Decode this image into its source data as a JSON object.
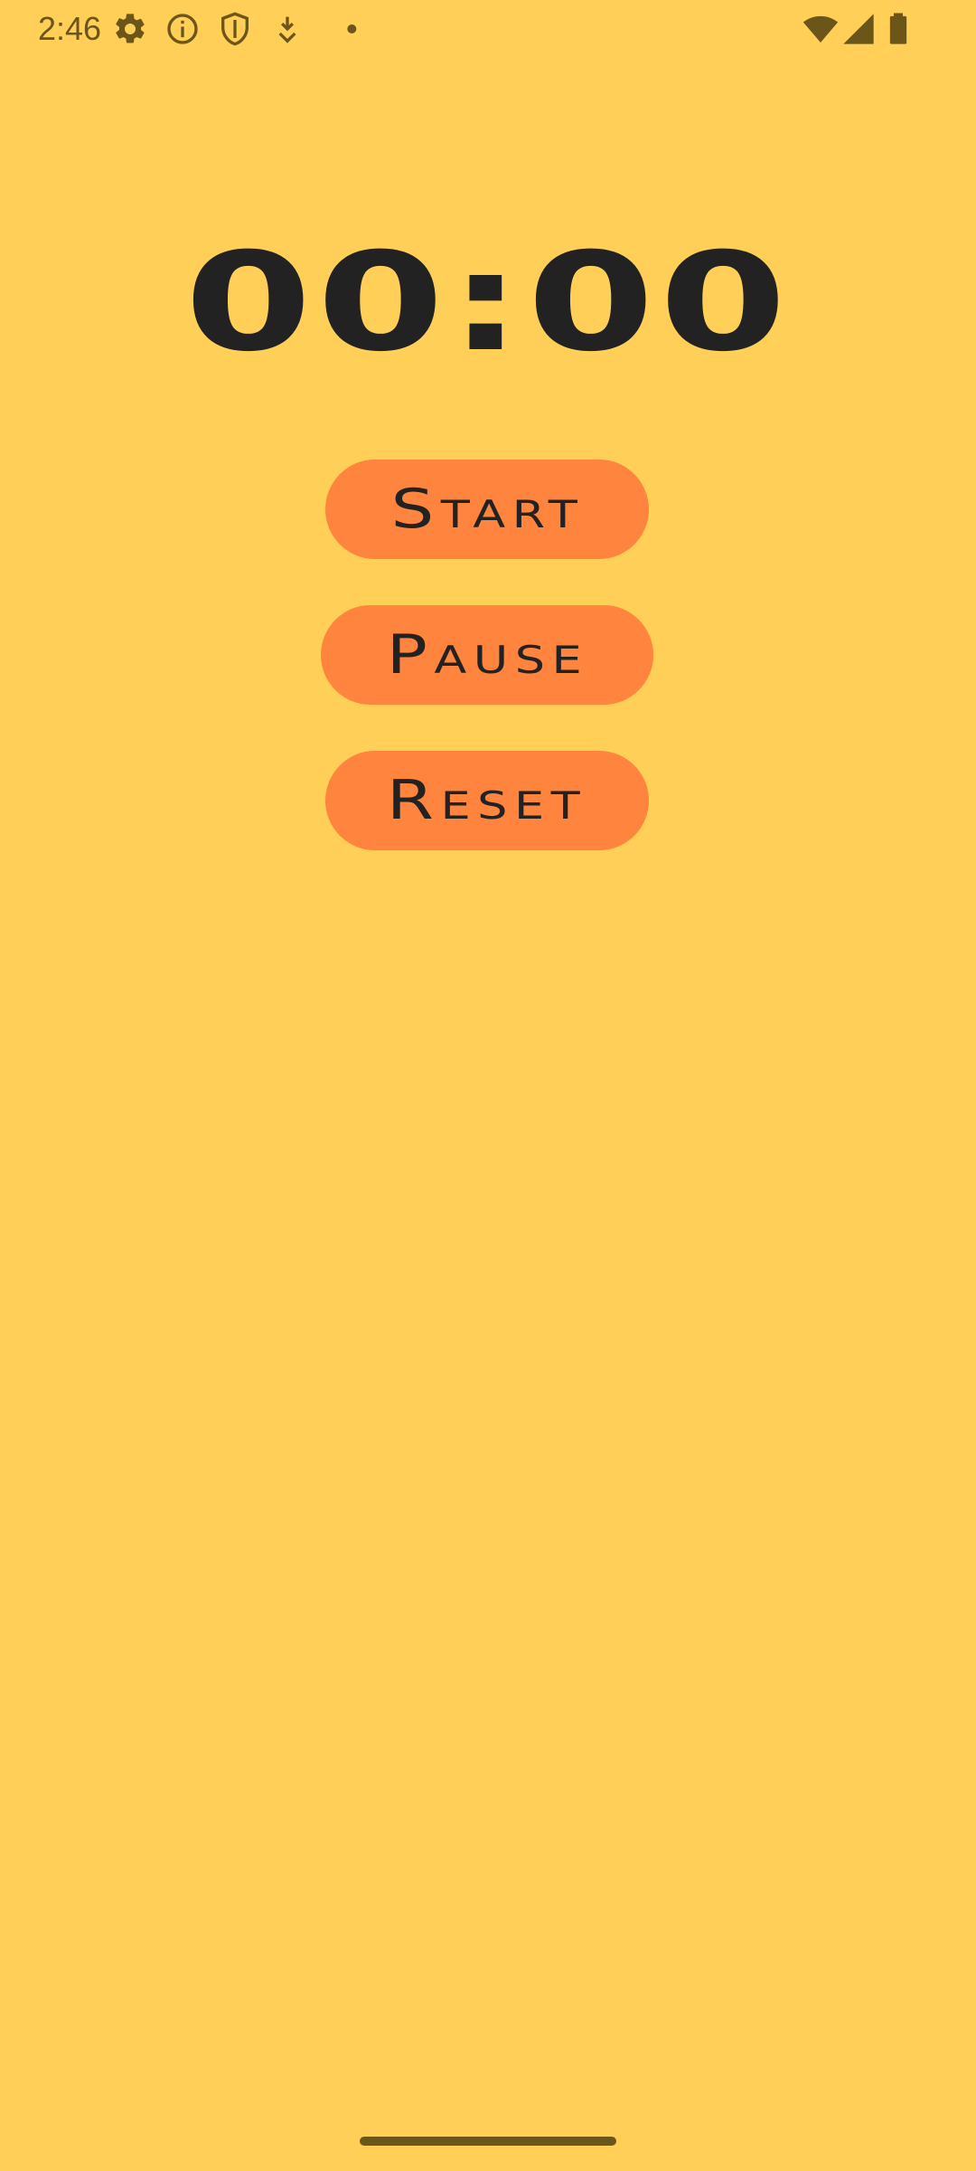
{
  "status_bar": {
    "time": "2:46",
    "left_icons": [
      "gear-icon",
      "info-icon",
      "shield-icon",
      "download-icon",
      "dot-icon"
    ],
    "right_icons": [
      "wifi-icon",
      "signal-icon",
      "battery-icon"
    ]
  },
  "timer": {
    "display": "00:00"
  },
  "controls": {
    "start_label": "Start",
    "pause_label": "Pause",
    "reset_label": "Reset"
  },
  "colors": {
    "background": "#FFCF57",
    "button": "#FF843D",
    "text": "#222222",
    "status": "#6B5518"
  }
}
